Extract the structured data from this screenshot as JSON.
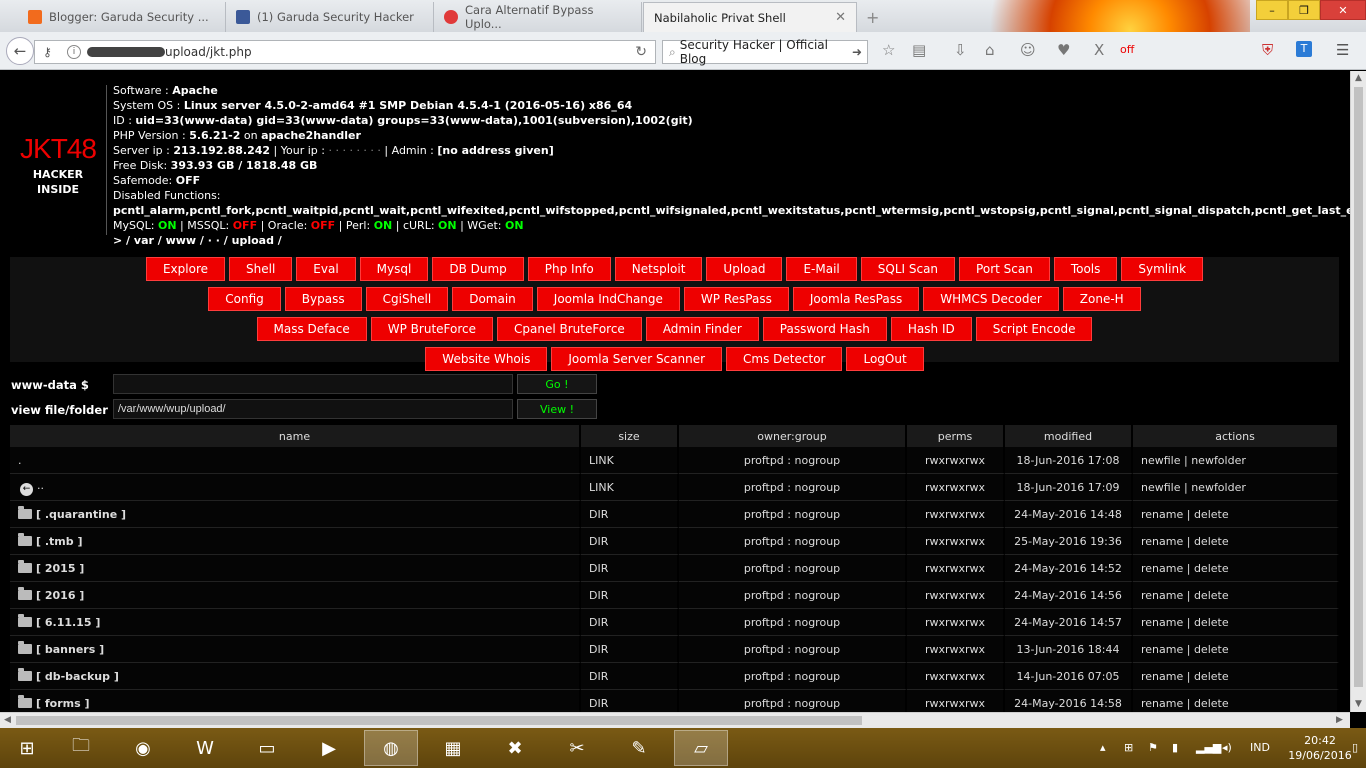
{
  "browser": {
    "tabs": [
      {
        "label": "Blogger: Garuda Security ...",
        "icon_color": "#f26b1d"
      },
      {
        "label": "(1) Garuda Security Hacker",
        "icon_color": "#3b5998"
      },
      {
        "label": "Cara Alternatif Bypass Uplo...",
        "icon_color": "#e03a3a"
      },
      {
        "label": "Nabilaholic Privat Shell",
        "icon_color": ""
      }
    ],
    "new_tab": "+",
    "url": "upload/jkt.php",
    "search_text": "Security Hacker | Official Blog",
    "toolbar_text": "off",
    "window_controls": {
      "minimize": "–",
      "maximize": "❐",
      "close": "✕"
    }
  },
  "shell": {
    "logo": "JKT48",
    "logo_sub": [
      "HACKER",
      "INSIDE"
    ],
    "info": {
      "software_label": "Software : ",
      "software": "Apache",
      "os_label": "System OS : ",
      "os": "Linux server 4.5.0-2-amd64 #1 SMP Debian 4.5.4-1 (2016-05-16) x86_64",
      "id_label": "ID : ",
      "id": "uid=33(www-data) gid=33(www-data) groups=33(www-data),1001(subversion),1002(git)",
      "php_label": "PHP Version : ",
      "php": "5.6.21-2",
      "php_on": " on ",
      "php_handler": "apache2handler",
      "server_ip_label": "Server ip : ",
      "server_ip": "213.192.88.242",
      "your_ip_label": " | Your ip : ",
      "your_ip": "· · · · · · · ·",
      "admin_label": " | Admin : ",
      "admin": "[no address given]",
      "disk_label": "Free Disk: ",
      "disk": "393.93 GB / 1818.48 GB",
      "safemode_label": "Safemode: ",
      "safemode": "OFF",
      "disabled_label": "Disabled Functions:",
      "disabled": "pcntl_alarm,pcntl_fork,pcntl_waitpid,pcntl_wait,pcntl_wifexited,pcntl_wifstopped,pcntl_wifsignaled,pcntl_wexitstatus,pcntl_wtermsig,pcntl_wstopsig,pcntl_signal,pcntl_signal_dispatch,pcntl_get_last_error,pcntl_strerror",
      "mysql_label": "MySQL: ",
      "mysql": "ON",
      "mssql_label": " | MSSQL: ",
      "mssql": "OFF",
      "oracle_label": " | Oracle: ",
      "oracle": "OFF",
      "perl_label": " | Perl: ",
      "perl": "ON",
      "curl_label": " | cURL: ",
      "curl": "ON",
      "wget_label": " | WGet: ",
      "wget": "ON",
      "path": " >  / var / www /  · ·  / upload /"
    },
    "menu_rows": [
      [
        "Explore",
        "Shell",
        "Eval",
        "Mysql",
        "DB Dump",
        "Php Info",
        "Netsploit",
        "Upload",
        "E-Mail",
        "SQLI Scan",
        "Port Scan",
        "Tools",
        "Symlink"
      ],
      [
        "Config",
        "Bypass",
        "CgiShell",
        "Domain",
        "Joomla IndChange",
        "WP ResPass",
        "Joomla ResPass",
        "WHMCS Decoder",
        "Zone-H"
      ],
      [
        "Mass Deface",
        "WP BruteForce",
        "Cpanel BruteForce",
        "Admin Finder",
        "Password Hash",
        "Hash ID",
        "Script Encode"
      ],
      [
        "Website Whois",
        "Joomla Server Scanner",
        "Cms Detector",
        "LogOut"
      ]
    ],
    "cmd": {
      "label": "www-data $",
      "value": "",
      "button": "Go !"
    },
    "view": {
      "label": "view file/folder",
      "value": "/var/www/wup/upload/",
      "button": "View !"
    },
    "table": {
      "headers": [
        "name",
        "size",
        "owner:group",
        "perms",
        "modified",
        "actions"
      ],
      "rows": [
        {
          "name": ".",
          "size": "LINK",
          "owner": "proftpd : nogroup",
          "perms": "rwxrwxrwx",
          "modified": "18-Jun-2016 17:08",
          "a1": "newfile",
          "a2": "newfolder"
        },
        {
          "name": "..",
          "size": "LINK",
          "owner": "proftpd : nogroup",
          "perms": "rwxrwxrwx",
          "modified": "18-Jun-2016 17:09",
          "a1": "newfile",
          "a2": "newfolder"
        },
        {
          "name": "[ .quarantine ]",
          "size": "DIR",
          "owner": "proftpd : nogroup",
          "perms": "rwxrwxrwx",
          "modified": "24-May-2016 14:48",
          "a1": "rename",
          "a2": "delete"
        },
        {
          "name": "[ .tmb ]",
          "size": "DIR",
          "owner": "proftpd : nogroup",
          "perms": "rwxrwxrwx",
          "modified": "25-May-2016 19:36",
          "a1": "rename",
          "a2": "delete"
        },
        {
          "name": "[ 2015 ]",
          "size": "DIR",
          "owner": "proftpd : nogroup",
          "perms": "rwxrwxrwx",
          "modified": "24-May-2016 14:52",
          "a1": "rename",
          "a2": "delete"
        },
        {
          "name": "[ 2016 ]",
          "size": "DIR",
          "owner": "proftpd : nogroup",
          "perms": "rwxrwxrwx",
          "modified": "24-May-2016 14:56",
          "a1": "rename",
          "a2": "delete"
        },
        {
          "name": "[ 6.11.15 ]",
          "size": "DIR",
          "owner": "proftpd : nogroup",
          "perms": "rwxrwxrwx",
          "modified": "24-May-2016 14:57",
          "a1": "rename",
          "a2": "delete"
        },
        {
          "name": "[ banners ]",
          "size": "DIR",
          "owner": "proftpd : nogroup",
          "perms": "rwxrwxrwx",
          "modified": "13-Jun-2016 18:44",
          "a1": "rename",
          "a2": "delete"
        },
        {
          "name": "[ db-backup ]",
          "size": "DIR",
          "owner": "proftpd : nogroup",
          "perms": "rwxrwxrwx",
          "modified": "14-Jun-2016 07:05",
          "a1": "rename",
          "a2": "delete"
        },
        {
          "name": "[ forms ]",
          "size": "DIR",
          "owner": "proftpd : nogroup",
          "perms": "rwxrwxrwx",
          "modified": "24-May-2016 14:58",
          "a1": "rename",
          "a2": "delete"
        }
      ],
      "action_sep": " | "
    }
  },
  "taskbar": {
    "language": "IND",
    "time": "20:42",
    "date": "19/06/2016"
  }
}
